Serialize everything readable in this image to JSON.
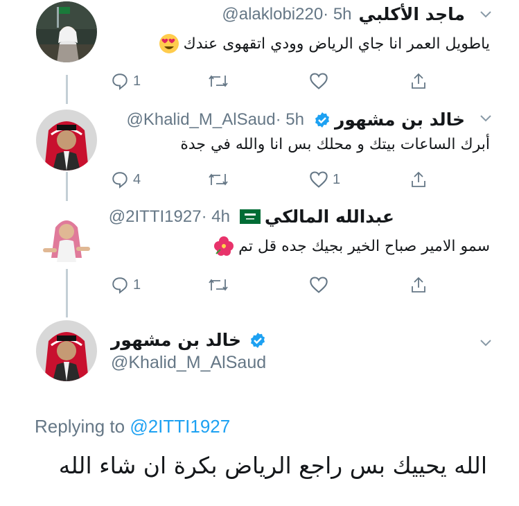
{
  "tweets": [
    {
      "name": "ماجد الأكلبي",
      "handle": "@alaklobi220",
      "time": "· 5h",
      "text": "ياطويل العمر انا جاي الرياض وودي اتقهوى عندك",
      "emoji": "heart-eyes-emoji",
      "reply_count": "1",
      "retweet_count": "",
      "like_count": ""
    },
    {
      "name": "خالد بن مشهور",
      "handle": "@Khalid_M_AlSaud",
      "time": "· 5h",
      "text": "أبرك الساعات بيتك و محلك بس انا والله في جدة",
      "reply_count": "4",
      "retweet_count": "",
      "like_count": "1"
    },
    {
      "name": "عبدالله المالكي",
      "handle": "@2ITTI1927",
      "time": "· 4h",
      "text": "سمو الامير صباح الخير بجيك جده قل تم",
      "emoji": "hibiscus-emoji",
      "reply_count": "1",
      "retweet_count": "",
      "like_count": ""
    }
  ],
  "main_tweet": {
    "name": "خالد بن مشهور",
    "handle": "@Khalid_M_AlSaud",
    "replying_prefix": "Replying to",
    "replying_handle": "@2ITTI1927",
    "text": "الله يحييك بس راجع الرياض بكرة ان شاء الله"
  },
  "colors": {
    "text": "#14171a",
    "secondary": "#657786",
    "link": "#1da1f2",
    "verified": "#1da1f2",
    "thread_line": "#c4cfd6"
  },
  "icons": {
    "reply": "reply-icon",
    "retweet": "retweet-icon",
    "like": "heart-icon",
    "share": "share-icon",
    "more": "chevron-down-icon",
    "verified": "verified-badge-icon"
  }
}
